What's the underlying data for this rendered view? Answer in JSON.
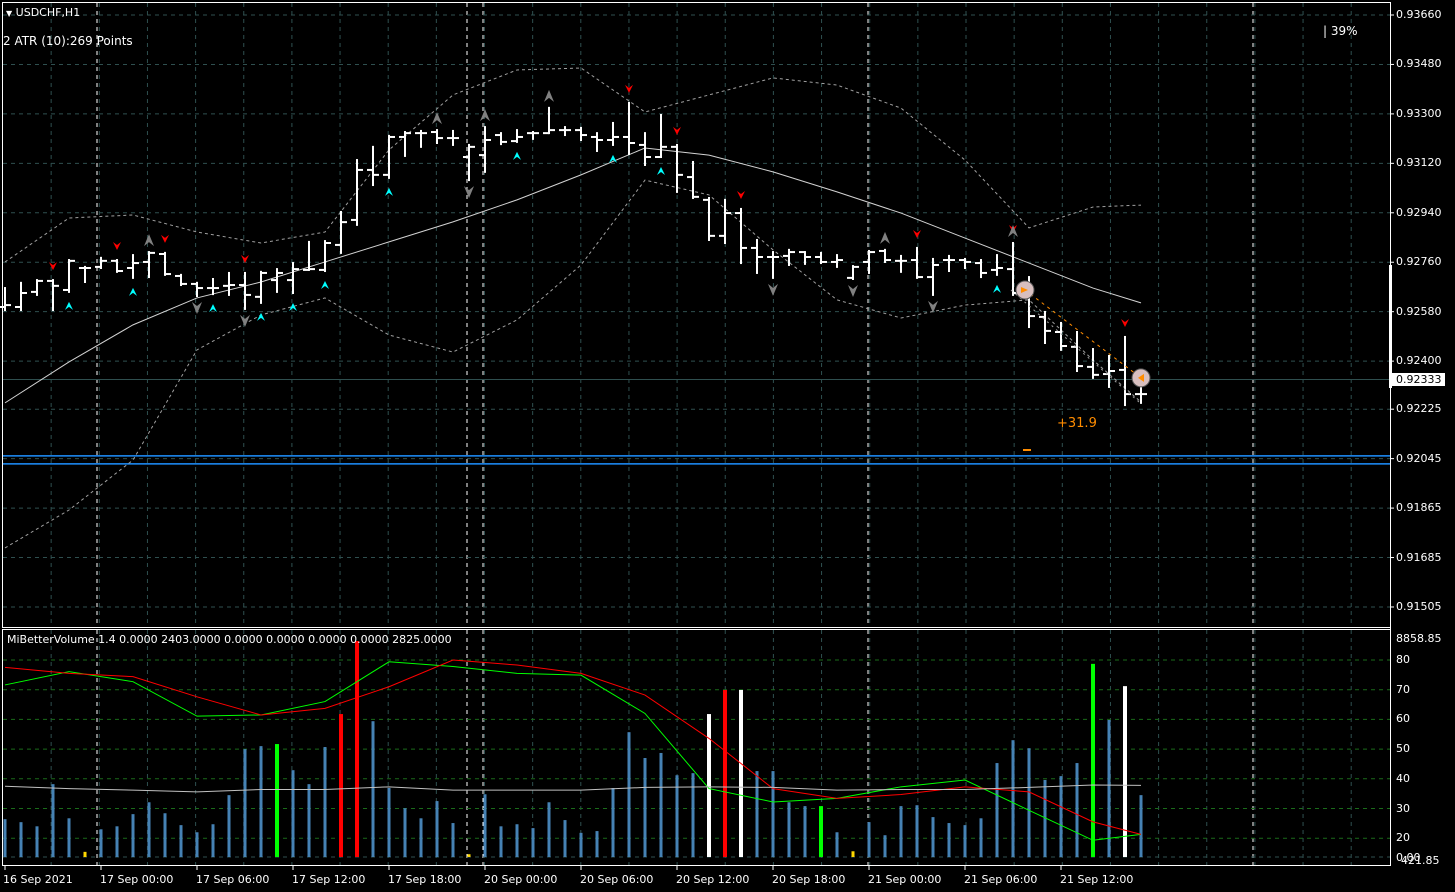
{
  "header": {
    "symbol_title": "USDCHF,H1",
    "atr_label": "2 ATR (10):269 Points",
    "percent_label": "| 39%"
  },
  "indicator": {
    "label": "MiBetterVolume 1.4 0.0000 2403.0000 0.0000 0.0000 0.0000 0.0000 2825.0000",
    "axis_top": "8858.85",
    "axis_bottom_a": "0.00",
    "axis_bottom_b": "421.85"
  },
  "trade": {
    "profit_label": "+31.9",
    "entry_price": 0.92659,
    "exit_price": 0.92339
  },
  "current_price_label": "0.92333",
  "colors": {
    "background": "#000000",
    "bars": "#ffffff",
    "grid": "#2f4f4f",
    "volume_bar": "#4682b4",
    "volume_green": "#00ff00",
    "volume_red": "#ff0000",
    "volume_white": "#ffffff",
    "volume_yellow": "#ffd700",
    "signal_down": "#ff0000",
    "signal_up": "#00ffff",
    "fractal": "#808080",
    "trade": "#ff8c00",
    "level_lines": "#1e90ff",
    "line_green": "#00ff00",
    "line_red": "#ff0000",
    "line_gray": "#c0c0c0"
  },
  "chart_data": [
    {
      "type": "ohlc",
      "title": "USDCHF,H1",
      "ylim": [
        0.91505,
        0.9366
      ],
      "y_ticks": [
        "0.93660",
        "0.93480",
        "0.93300",
        "0.93120",
        "0.92940",
        "0.92760",
        "0.92580",
        "0.92400",
        "0.92225",
        "0.92045",
        "0.91865",
        "0.91685",
        "0.91505"
      ],
      "x_ticks": [
        {
          "bar": 0,
          "label": "16 Sep 2021"
        },
        {
          "bar": 6,
          "label": "17 Sep 00:00"
        },
        {
          "bar": 12,
          "label": "17 Sep 06:00"
        },
        {
          "bar": 18,
          "label": "17 Sep 12:00"
        },
        {
          "bar": 24,
          "label": "17 Sep 18:00"
        },
        {
          "bar": 30,
          "label": "20 Sep 00:00"
        },
        {
          "bar": 36,
          "label": "20 Sep 06:00"
        },
        {
          "bar": 42,
          "label": "20 Sep 12:00"
        },
        {
          "bar": 48,
          "label": "20 Sep 18:00"
        },
        {
          "bar": 54,
          "label": "21 Sep 00:00"
        },
        {
          "bar": 60,
          "label": "21 Sep 06:00"
        },
        {
          "bar": 66,
          "label": "21 Sep 12:00"
        }
      ],
      "ohlc": [
        [
          0.92597,
          0.92666,
          0.92586,
          0.92604
        ],
        [
          0.92597,
          0.92685,
          0.92586,
          0.92648
        ],
        [
          0.92652,
          0.92695,
          0.92641,
          0.92692
        ],
        [
          0.92692,
          0.92695,
          0.92586,
          0.92674
        ],
        [
          0.92659,
          0.92768,
          0.92652,
          0.92765
        ],
        [
          0.92739,
          0.92743,
          0.92688,
          0.92739
        ],
        [
          0.92743,
          0.92776,
          0.92739,
          0.92765
        ],
        [
          0.92765,
          0.92768,
          0.92725,
          0.92728
        ],
        [
          0.92739,
          0.92786,
          0.92703,
          0.92757
        ],
        [
          0.92761,
          0.92797,
          0.92706,
          0.92794
        ],
        [
          0.9279,
          0.92794,
          0.92714,
          0.92717
        ],
        [
          0.9271,
          0.92714,
          0.92677,
          0.92681
        ],
        [
          0.92681,
          0.92685,
          0.92637,
          0.92666
        ],
        [
          0.92666,
          0.92699,
          0.92644,
          0.92666
        ],
        [
          0.92674,
          0.92721,
          0.92641,
          0.92677
        ],
        [
          0.92677,
          0.92721,
          0.9259,
          0.92641
        ],
        [
          0.92634,
          0.92725,
          0.92612,
          0.92721
        ],
        [
          0.92695,
          0.92735,
          0.92652,
          0.92721
        ],
        [
          0.92695,
          0.92757,
          0.92648,
          0.92735
        ],
        [
          0.92732,
          0.92834,
          0.92732,
          0.92735
        ],
        [
          0.92732,
          0.92837,
          0.92728,
          0.9283
        ],
        [
          0.92823,
          0.92943,
          0.92794,
          0.92906
        ],
        [
          0.92914,
          0.93132,
          0.92896,
          0.93096
        ],
        [
          0.93096,
          0.9318,
          0.93041,
          0.93078
        ],
        [
          0.93078,
          0.9322,
          0.93067,
          0.93216
        ],
        [
          0.93216,
          0.93234,
          0.93147,
          0.9323
        ],
        [
          0.9323,
          0.93238,
          0.9318,
          0.9323
        ],
        [
          0.93234,
          0.93241,
          0.93194,
          0.93212
        ],
        [
          0.93212,
          0.93238,
          0.93187,
          0.93212
        ],
        [
          0.93143,
          0.93187,
          0.93059,
          0.9318
        ],
        [
          0.9315,
          0.93252,
          0.93089,
          0.93205
        ],
        [
          0.93223,
          0.9323,
          0.9319,
          0.93198
        ],
        [
          0.93201,
          0.93241,
          0.93198,
          0.93216
        ],
        [
          0.9323,
          0.93234,
          0.93209,
          0.9323
        ],
        [
          0.9323,
          0.93322,
          0.9323,
          0.93241
        ],
        [
          0.93241,
          0.93252,
          0.93223,
          0.93241
        ],
        [
          0.93241,
          0.93249,
          0.93205,
          0.93223
        ],
        [
          0.93216,
          0.9323,
          0.93165,
          0.93205
        ],
        [
          0.93205,
          0.93267,
          0.93187,
          0.93216
        ],
        [
          0.93216,
          0.9334,
          0.93154,
          0.93194
        ],
        [
          0.93187,
          0.9323,
          0.93114,
          0.93143
        ],
        [
          0.93143,
          0.93296,
          0.93143,
          0.9318
        ],
        [
          0.9318,
          0.93187,
          0.93016,
          0.93078
        ],
        [
          0.9307,
          0.93125,
          0.92994,
          0.92998
        ],
        [
          0.92987,
          0.92994,
          0.92841,
          0.92856
        ],
        [
          0.92856,
          0.92987,
          0.9283,
          0.92939
        ],
        [
          0.92939,
          0.92954,
          0.92757,
          0.92812
        ],
        [
          0.92812,
          0.92841,
          0.92721,
          0.92779
        ],
        [
          0.92779,
          0.92797,
          0.92703,
          0.92779
        ],
        [
          0.92783,
          0.92805,
          0.9275,
          0.92797
        ],
        [
          0.92797,
          0.92797,
          0.92754,
          0.92779
        ],
        [
          0.92779,
          0.92794,
          0.92757,
          0.92761
        ],
        [
          0.92761,
          0.92786,
          0.92743,
          0.92768
        ],
        [
          0.92703,
          0.92746,
          0.92699,
          0.92743
        ],
        [
          0.92761,
          0.92801,
          0.92721,
          0.92797
        ],
        [
          0.92801,
          0.92805,
          0.92761,
          0.92768
        ],
        [
          0.92765,
          0.92783,
          0.92725,
          0.92765
        ],
        [
          0.92768,
          0.92812,
          0.92703,
          0.92706
        ],
        [
          0.92706,
          0.92772,
          0.92641,
          0.9275
        ],
        [
          0.92768,
          0.92783,
          0.92728,
          0.92768
        ],
        [
          0.92768,
          0.92772,
          0.92739,
          0.92761
        ],
        [
          0.92757,
          0.92768,
          0.92706,
          0.92721
        ],
        [
          0.92732,
          0.92786,
          0.92714,
          0.92739
        ],
        [
          0.92735,
          0.9283,
          0.92641,
          0.92648
        ],
        [
          0.92652,
          0.92706,
          0.92524,
          0.92564
        ],
        [
          0.92561,
          0.92579,
          0.92466,
          0.9251
        ],
        [
          0.92506,
          0.92539,
          0.92441,
          0.92455
        ],
        [
          0.92452,
          0.92506,
          0.92364,
          0.92382
        ],
        [
          0.92379,
          0.92444,
          0.92339,
          0.9235
        ],
        [
          0.92353,
          0.92419,
          0.92306,
          0.92364
        ],
        [
          0.92368,
          0.92488,
          0.9224,
          0.9228
        ],
        [
          0.9228,
          0.92331,
          0.92248,
          0.9228
        ]
      ],
      "sample_bars": [
        0,
        4,
        8,
        12,
        16,
        20,
        24,
        28,
        32,
        36,
        40,
        44,
        48,
        52,
        56,
        60,
        64,
        68,
        71
      ],
      "series": [
        {
          "name": "moving-average",
          "color": "#d3d3d3",
          "style": "solid",
          "values": [
            0.92248,
            0.92397,
            0.92532,
            0.9263,
            0.92688,
            0.92761,
            0.92834,
            0.92907,
            0.92987,
            0.93078,
            0.93176,
            0.9315,
            0.93089,
            0.93016,
            0.92939,
            0.92848,
            0.92757,
            0.92666,
            0.92612
          ]
        },
        {
          "name": "upper-band",
          "color": "#a0a0a0",
          "style": "dashed",
          "values": [
            0.92761,
            0.92921,
            0.92932,
            0.9287,
            0.9283,
            0.9287,
            0.93169,
            0.93369,
            0.9346,
            0.93467,
            0.93307,
            0.93369,
            0.93431,
            0.93405,
            0.93321,
            0.93132,
            0.92885,
            0.92961,
            0.92968
          ]
        },
        {
          "name": "lower-band",
          "color": "#a0a0a0",
          "style": "dashed",
          "values": [
            0.9172,
            0.91858,
            0.9204,
            0.92441,
            0.92568,
            0.9263,
            0.92495,
            0.92433,
            0.9255,
            0.9275,
            0.93059,
            0.93005,
            0.92805,
            0.92623,
            0.92557,
            0.92604,
            0.92623,
            0.92404,
            0.92251
          ]
        }
      ],
      "signals": [
        {
          "bar": 3,
          "kind": "red-down"
        },
        {
          "bar": 7,
          "kind": "red-down"
        },
        {
          "bar": 10,
          "kind": "red-down"
        },
        {
          "bar": 15,
          "kind": "red-down"
        },
        {
          "bar": 39,
          "kind": "red-down"
        },
        {
          "bar": 42,
          "kind": "red-down"
        },
        {
          "bar": 46,
          "kind": "red-down"
        },
        {
          "bar": 57,
          "kind": "red-down"
        },
        {
          "bar": 63,
          "kind": "red-down"
        },
        {
          "bar": 70,
          "kind": "red-down"
        },
        {
          "bar": 4,
          "kind": "cyan-up"
        },
        {
          "bar": 8,
          "kind": "cyan-up"
        },
        {
          "bar": 13,
          "kind": "cyan-up"
        },
        {
          "bar": 16,
          "kind": "cyan-up"
        },
        {
          "bar": 18,
          "kind": "cyan-up"
        },
        {
          "bar": 20,
          "kind": "cyan-up"
        },
        {
          "bar": 24,
          "kind": "cyan-up"
        },
        {
          "bar": 32,
          "kind": "cyan-up"
        },
        {
          "bar": 38,
          "kind": "cyan-up"
        },
        {
          "bar": 41,
          "kind": "cyan-up"
        },
        {
          "bar": 62,
          "kind": "cyan-up"
        },
        {
          "bar": 9,
          "kind": "fractal-up"
        },
        {
          "bar": 27,
          "kind": "fractal-up"
        },
        {
          "bar": 30,
          "kind": "fractal-up"
        },
        {
          "bar": 34,
          "kind": "fractal-up"
        },
        {
          "bar": 55,
          "kind": "fractal-up"
        },
        {
          "bar": 63,
          "kind": "fractal-up"
        },
        {
          "bar": 12,
          "kind": "fractal-down"
        },
        {
          "bar": 15,
          "kind": "fractal-down"
        },
        {
          "bar": 29,
          "kind": "fractal-down"
        },
        {
          "bar": 48,
          "kind": "fractal-down"
        },
        {
          "bar": 53,
          "kind": "fractal-down"
        },
        {
          "bar": 58,
          "kind": "fractal-down"
        }
      ],
      "levels": [
        0.92055,
        0.92026
      ],
      "bid": 0.92333
    },
    {
      "type": "bar",
      "title": "MiBetterVolume 1.4",
      "ylim": [
        10,
        90
      ],
      "y_ticks": [
        "80",
        "70",
        "60",
        "50",
        "40",
        "30",
        "20"
      ],
      "volume": [
        26.4,
        25.4,
        24.0,
        38.2,
        26.7,
        15.4,
        23.0,
        24.0,
        28.1,
        32.1,
        28.4,
        24.4,
        22.0,
        24.7,
        34.5,
        50.0,
        51.0,
        51.7,
        42.9,
        38.2,
        50.7,
        61.8,
        86.4,
        59.4,
        36.9,
        30.1,
        26.7,
        32.5,
        25.1,
        14.6,
        34.8,
        24.0,
        24.7,
        23.4,
        32.1,
        26.1,
        21.8,
        22.4,
        36.9,
        55.7,
        47.0,
        48.7,
        41.2,
        41.9,
        61.8,
        69.9,
        69.9,
        42.6,
        42.6,
        32.1,
        30.8,
        30.8,
        22.0,
        15.6,
        25.4,
        21.0,
        30.8,
        31.1,
        27.1,
        25.1,
        24.4,
        26.7,
        45.3,
        53.0,
        50.3,
        39.6,
        40.9,
        45.3,
        78.7,
        59.8,
        71.2,
        34.5
      ],
      "volume_colors": {
        "5": "yellow",
        "17": "green",
        "21": "red",
        "22": "red",
        "29": "yellow",
        "44": "white",
        "45": "red",
        "46": "white",
        "51": "green",
        "53": "yellow",
        "68": "green",
        "70": "white"
      },
      "sample_bars": [
        0,
        4,
        8,
        12,
        16,
        20,
        24,
        28,
        32,
        36,
        40,
        44,
        48,
        52,
        56,
        60,
        64,
        68,
        71
      ],
      "series": [
        {
          "name": "green-line",
          "color": "#00ff00",
          "values": [
            71.6,
            76.1,
            72.7,
            61.1,
            61.5,
            66.0,
            79.4,
            77.8,
            75.5,
            74.9,
            62.0,
            36.7,
            32.2,
            33.4,
            37.3,
            39.6,
            29.4,
            19.3,
            21.3
          ]
        },
        {
          "name": "red-line",
          "color": "#ff0000",
          "values": [
            77.5,
            75.5,
            74.4,
            67.6,
            61.5,
            63.7,
            71.0,
            80.0,
            78.3,
            75.5,
            68.2,
            53.6,
            36.7,
            33.4,
            34.7,
            37.3,
            35.6,
            25.5,
            21.3
          ]
        },
        {
          "name": "gray-line",
          "color": "#c0c0c0",
          "values": [
            37.5,
            36.7,
            36.2,
            35.6,
            36.4,
            36.4,
            37.3,
            36.2,
            36.2,
            36.2,
            37.1,
            37.3,
            37.1,
            36.2,
            36.4,
            36.4,
            37.1,
            37.9,
            37.8
          ]
        }
      ]
    }
  ]
}
